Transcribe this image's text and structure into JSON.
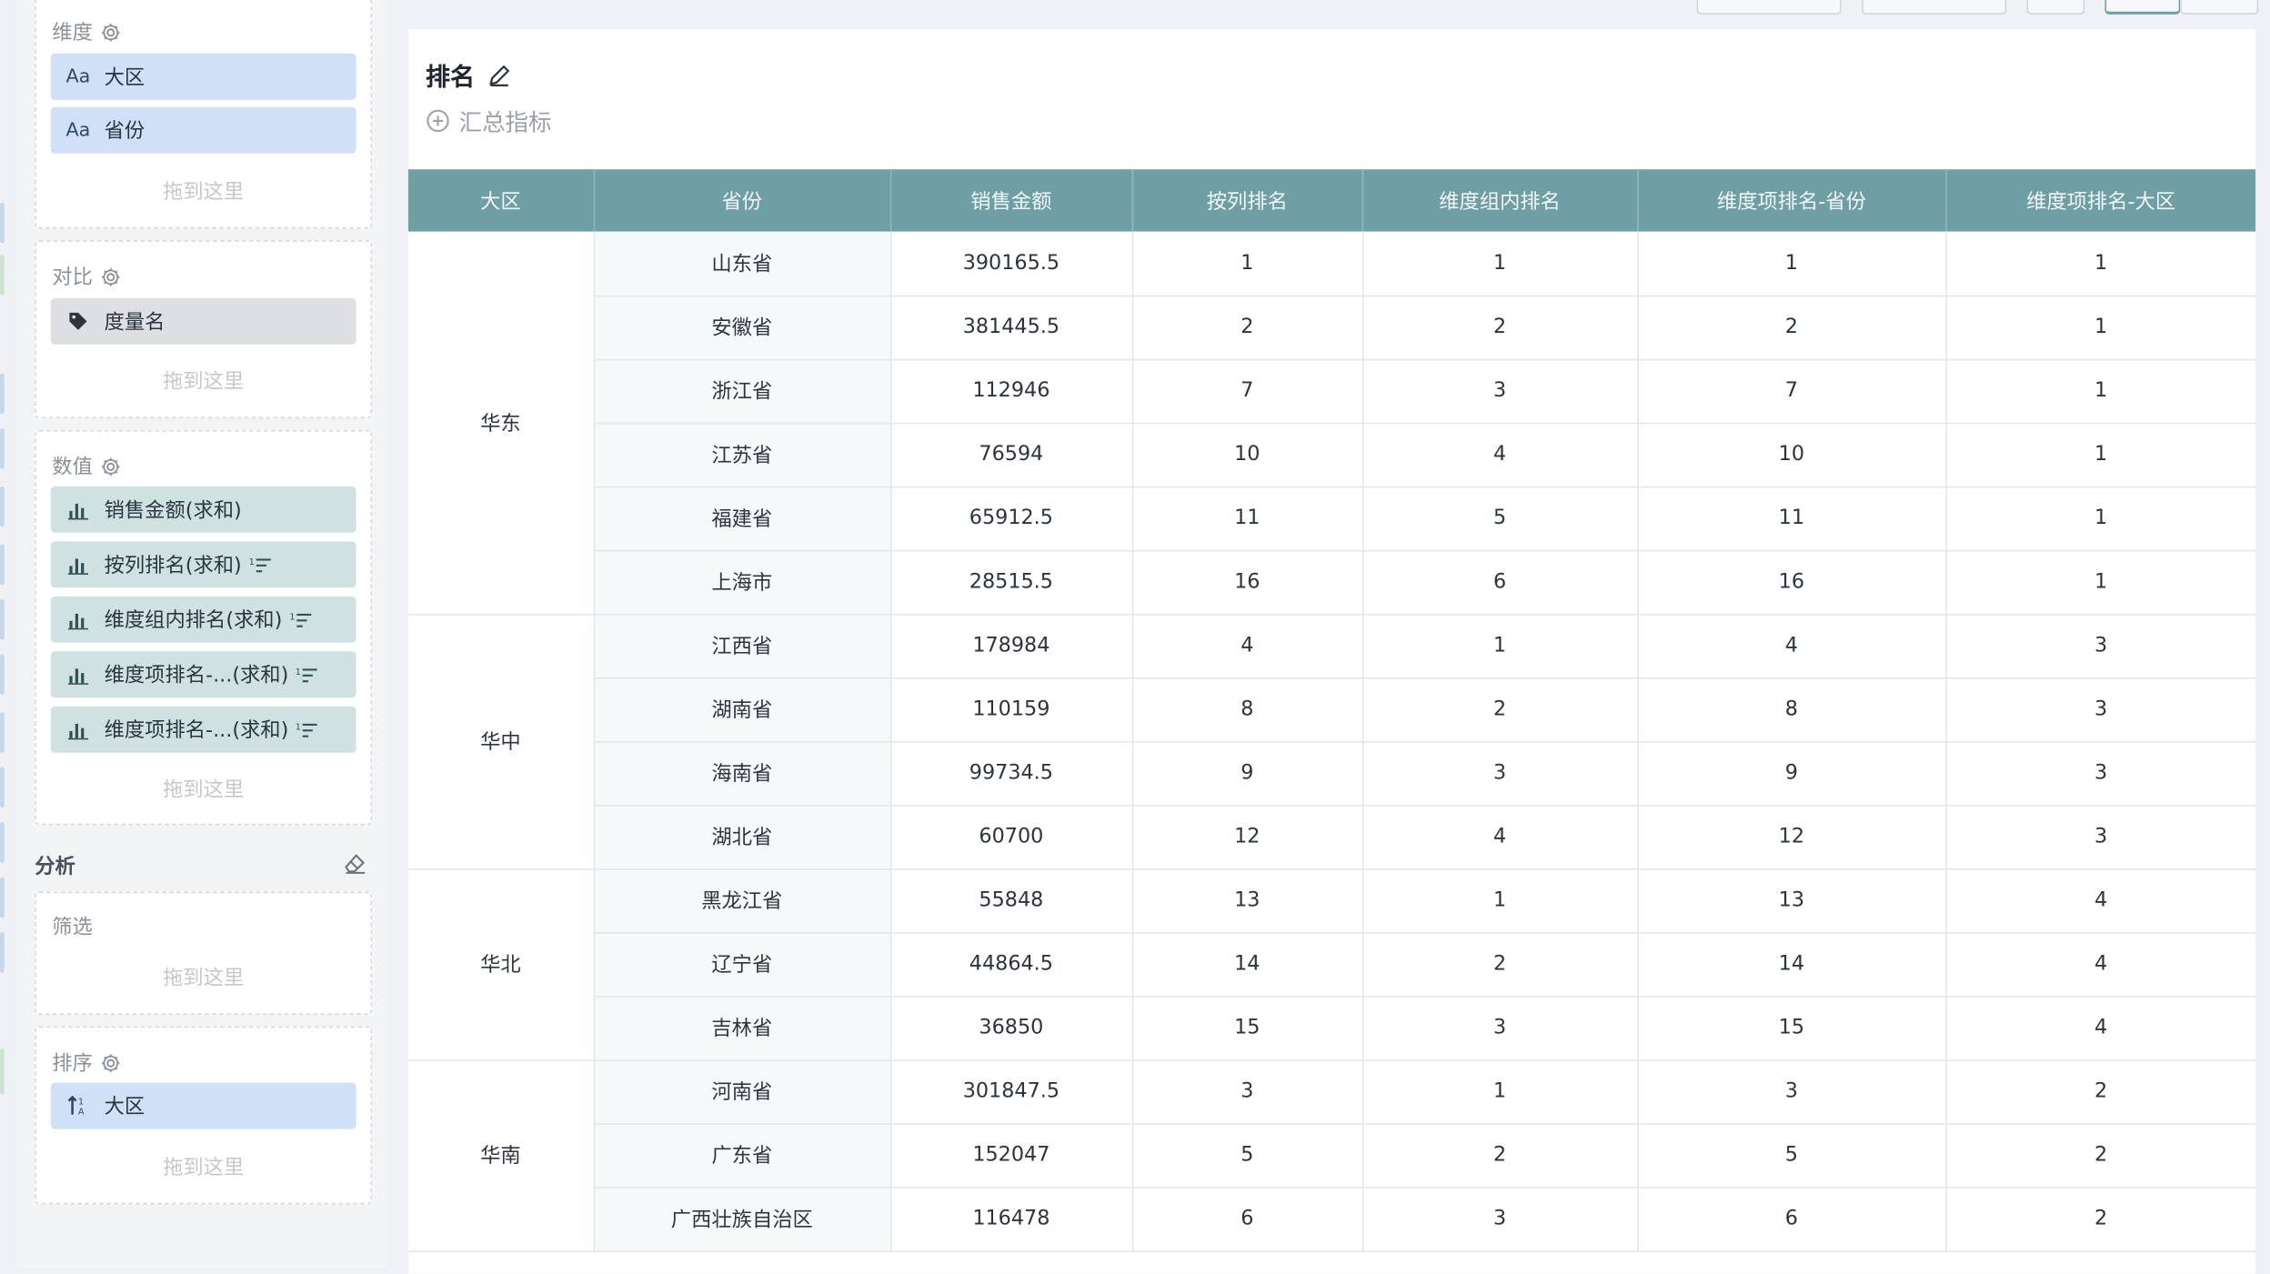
{
  "panel": {
    "dimension": {
      "title": "维度",
      "items": [
        {
          "icon_text": "Aa",
          "label": "大区"
        },
        {
          "icon_text": "Aa",
          "label": "省份"
        }
      ],
      "hint": "拖到这里"
    },
    "compare": {
      "title": "对比",
      "items": [
        {
          "icon": "tag-icon",
          "label": "度量名"
        }
      ],
      "hint": "拖到这里"
    },
    "values": {
      "title": "数值",
      "items": [
        {
          "icon": "bar-chart-icon",
          "label": "销售金额(求和)",
          "rank": false
        },
        {
          "icon": "bar-chart-icon",
          "label": "按列排名(求和)",
          "rank": true
        },
        {
          "icon": "bar-chart-icon",
          "label": "维度组内排名(求和)",
          "rank": true
        },
        {
          "icon": "bar-chart-icon",
          "label": "维度项排名-...(求和)",
          "rank": true
        },
        {
          "icon": "bar-chart-icon",
          "label": "维度项排名-...(求和)",
          "rank": true
        }
      ],
      "hint": "拖到这里"
    },
    "analysis": {
      "title": "分析"
    },
    "filter": {
      "title": "筛选",
      "hint": "拖到这里"
    },
    "sort": {
      "title": "排序",
      "items": [
        {
          "icon": "sort-asc-icon",
          "label": "大区"
        }
      ],
      "hint": "拖到这里"
    }
  },
  "card": {
    "title": "排名",
    "summary_label": "汇总指标"
  },
  "table": {
    "columns": [
      "大区",
      "省份",
      "销售金额",
      "按列排名",
      "维度组内排名",
      "维度项排名-省份",
      "维度项排名-大区"
    ],
    "groups": [
      {
        "region": "华东",
        "rows": [
          [
            "山东省",
            "390165.5",
            "1",
            "1",
            "1",
            "1"
          ],
          [
            "安徽省",
            "381445.5",
            "2",
            "2",
            "2",
            "1"
          ],
          [
            "浙江省",
            "112946",
            "7",
            "3",
            "7",
            "1"
          ],
          [
            "江苏省",
            "76594",
            "10",
            "4",
            "10",
            "1"
          ],
          [
            "福建省",
            "65912.5",
            "11",
            "5",
            "11",
            "1"
          ],
          [
            "上海市",
            "28515.5",
            "16",
            "6",
            "16",
            "1"
          ]
        ]
      },
      {
        "region": "华中",
        "rows": [
          [
            "江西省",
            "178984",
            "4",
            "1",
            "4",
            "3"
          ],
          [
            "湖南省",
            "110159",
            "8",
            "2",
            "8",
            "3"
          ],
          [
            "海南省",
            "99734.5",
            "9",
            "3",
            "9",
            "3"
          ],
          [
            "湖北省",
            "60700",
            "12",
            "4",
            "12",
            "3"
          ]
        ]
      },
      {
        "region": "华北",
        "rows": [
          [
            "黑龙江省",
            "55848",
            "13",
            "1",
            "13",
            "4"
          ],
          [
            "辽宁省",
            "44864.5",
            "14",
            "2",
            "14",
            "4"
          ],
          [
            "吉林省",
            "36850",
            "15",
            "3",
            "15",
            "4"
          ]
        ]
      },
      {
        "region": "华南",
        "rows": [
          [
            "河南省",
            "301847.5",
            "3",
            "1",
            "3",
            "2"
          ],
          [
            "广东省",
            "152047",
            "5",
            "2",
            "5",
            "2"
          ],
          [
            "广西壮族自治区",
            "116478",
            "6",
            "3",
            "6",
            "2"
          ]
        ]
      }
    ]
  }
}
